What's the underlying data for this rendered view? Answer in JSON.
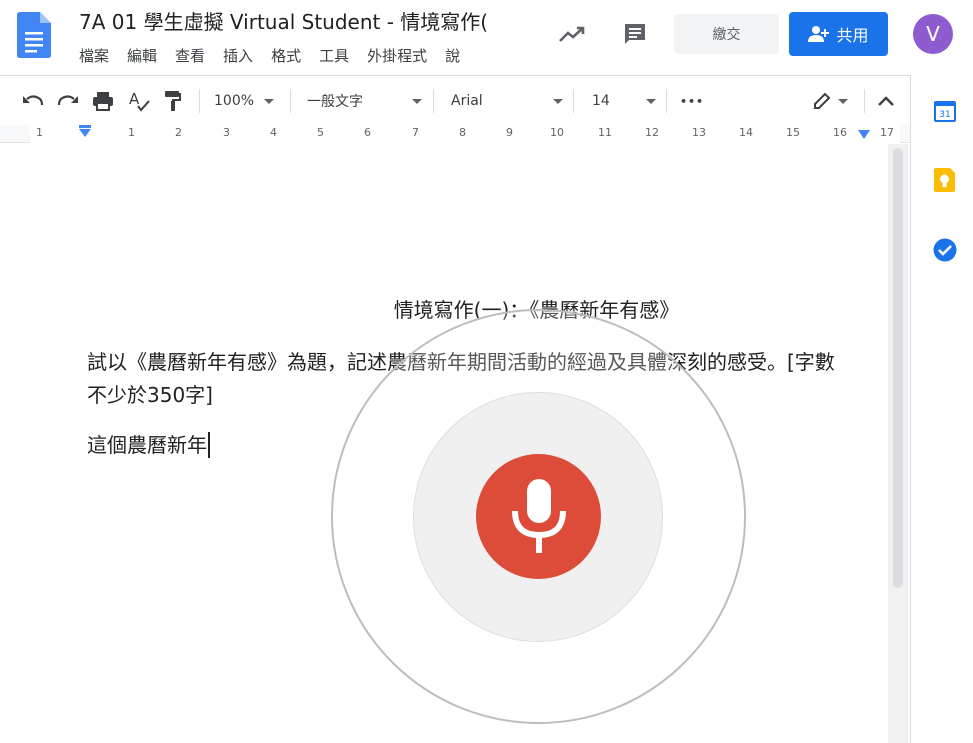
{
  "app": {
    "title": "7A 01 學生虛擬 Virtual Student - 情境寫作(",
    "menu": [
      "檔案",
      "編輯",
      "查看",
      "插入",
      "格式",
      "工具",
      "外掛程式",
      "說"
    ],
    "submit_label": "繳交",
    "share_label": "共用",
    "avatar_letter": "V",
    "colors": {
      "brand_blue": "#1a73e8",
      "mic_red": "#dd4b39",
      "avatar_purple": "#8e5bd0"
    }
  },
  "toolbar": {
    "zoom": "100%",
    "style": "一般文字",
    "font": "Arial",
    "font_size": "14",
    "more": "•••"
  },
  "ruler": {
    "numbers": [
      "1",
      "1",
      "2",
      "3",
      "4",
      "5",
      "6",
      "7",
      "8",
      "9",
      "10",
      "11",
      "12",
      "13",
      "14",
      "15",
      "16",
      "17"
    ]
  },
  "document": {
    "heading": "情境寫作(一)：《農曆新年有感》",
    "prompt": "試以《農曆新年有感》為題，記述農曆新年期間活動的經過及具體深刻的感受。[字數不少於350字]",
    "typed_text": "這個農曆新年"
  },
  "side_panel": {
    "icons": [
      "calendar-icon",
      "keep-icon",
      "tasks-icon"
    ],
    "calendar_day": "31"
  },
  "voice": {
    "icon": "microphone-icon",
    "state": "listening"
  }
}
